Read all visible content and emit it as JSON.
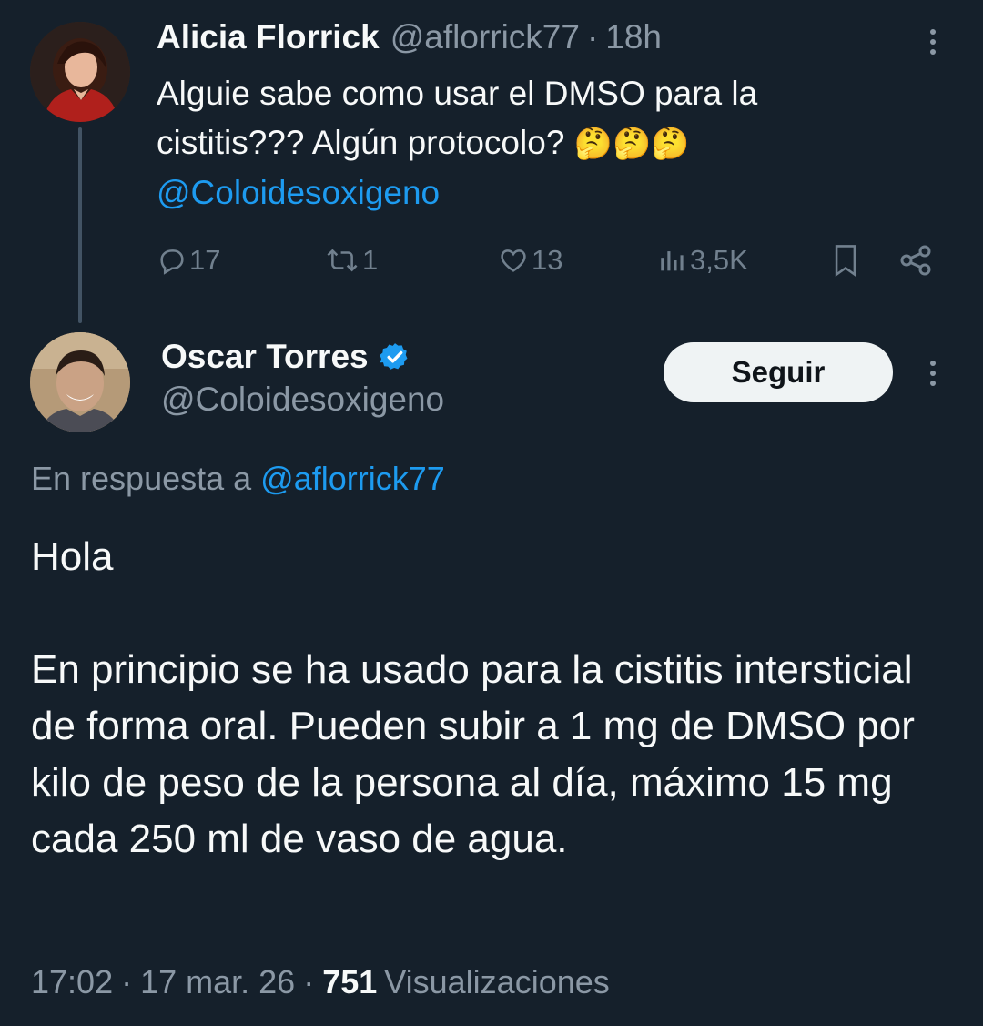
{
  "parent_tweet": {
    "author_name": "Alicia Florrick",
    "handle": "@aflorrick77",
    "separator": "·",
    "time": "18h",
    "text_line1": "Alguie sabe como usar el DMSO para la",
    "text_line2": "cistitis??? Algún protocolo?",
    "emojis": "🤔🤔🤔",
    "mention": "@Coloidesoxigeno",
    "stats": {
      "replies": "17",
      "retweets": "1",
      "likes": "13",
      "views": "3,5K"
    }
  },
  "reply_tweet": {
    "author_name": "Oscar Torres",
    "handle": "@Coloidesoxigeno",
    "verified": true,
    "follow_label": "Seguir",
    "reply_prefix": "En respuesta a",
    "reply_to": "@aflorrick77",
    "paragraph1": "Hola",
    "paragraph2": "En principio se ha usado para la cistitis intersticial de forma oral. Pueden subir a 1 mg de DMSO por kilo de peso de la persona al día, máximo 15 mg cada 250 ml de vaso de agua.",
    "time": "17:02",
    "date": "17 mar. 26",
    "separator": "·",
    "views_count": "751",
    "views_label": "Visualizaciones"
  },
  "colors": {
    "background": "#15202b",
    "text": "#f7f9f9",
    "secondary": "#8b98a5",
    "link": "#1d9bf0",
    "verified": "#1d9bf0",
    "follow_bg": "#eff3f4"
  },
  "icons": [
    "reply-icon",
    "retweet-icon",
    "like-icon",
    "views-icon",
    "bookmark-icon",
    "share-icon",
    "more-icon",
    "verified-badge-icon"
  ]
}
